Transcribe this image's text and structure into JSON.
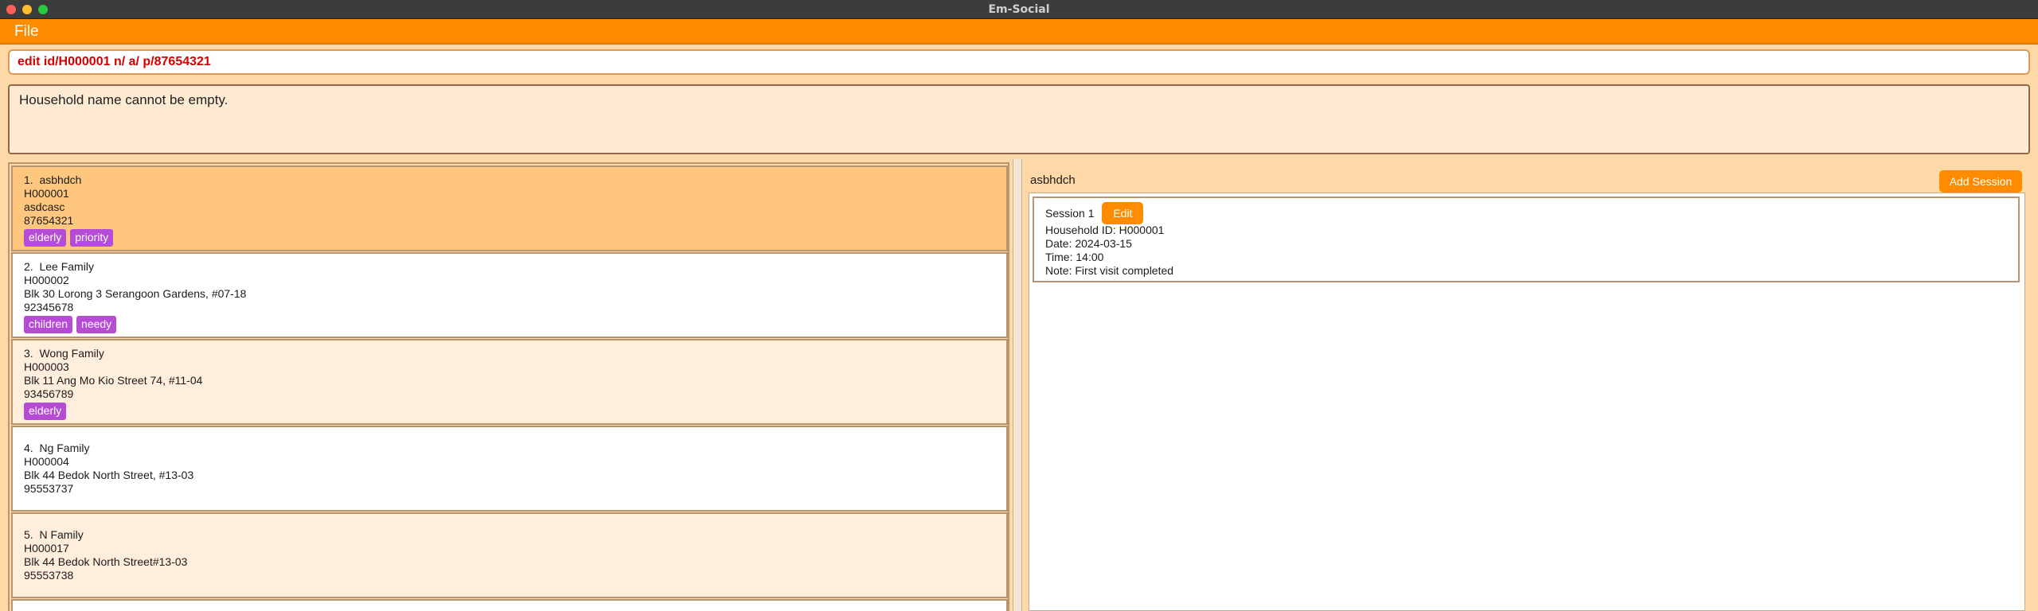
{
  "window": {
    "title": "Em-Social"
  },
  "menu": {
    "file_label": "File"
  },
  "command": {
    "value": "edit id/H000001 n/ a/ p/87654321"
  },
  "result": {
    "message": "Household name cannot be empty."
  },
  "households": [
    {
      "index": "1.",
      "name": "asbhdch",
      "id": "H000001",
      "address": "asdcasc",
      "phone": "87654321",
      "tags": [
        "elderly",
        "priority"
      ]
    },
    {
      "index": "2.",
      "name": "Lee Family",
      "id": "H000002",
      "address": "Blk 30 Lorong 3 Serangoon Gardens, #07-18",
      "phone": "92345678",
      "tags": [
        "children",
        "needy"
      ]
    },
    {
      "index": "3.",
      "name": "Wong Family",
      "id": "H000003",
      "address": "Blk 11 Ang Mo Kio Street 74, #11-04",
      "phone": "93456789",
      "tags": [
        "elderly"
      ]
    },
    {
      "index": "4.",
      "name": "Ng Family",
      "id": "H000004",
      "address": "Blk 44 Bedok North Street, #13-03",
      "phone": "95553737",
      "tags": []
    },
    {
      "index": "5.",
      "name": "N Family",
      "id": "H000017",
      "address": "Blk 44 Bedok North Street#13-03",
      "phone": "95553738",
      "tags": []
    }
  ],
  "detail": {
    "household_name": "asbhdch",
    "add_session_label": "Add Session",
    "sessions": [
      {
        "title": "Session 1",
        "edit_label": "Edit",
        "household_id": "Household ID: H000001",
        "date": "Date: 2024-03-15",
        "time": "Time: 14:00",
        "note": "Note: First visit completed"
      }
    ]
  },
  "colors": {
    "accent": "#ff8c00",
    "tag": "#b64bd6",
    "selected": "#ffc77e",
    "error_text": "#d20000"
  }
}
